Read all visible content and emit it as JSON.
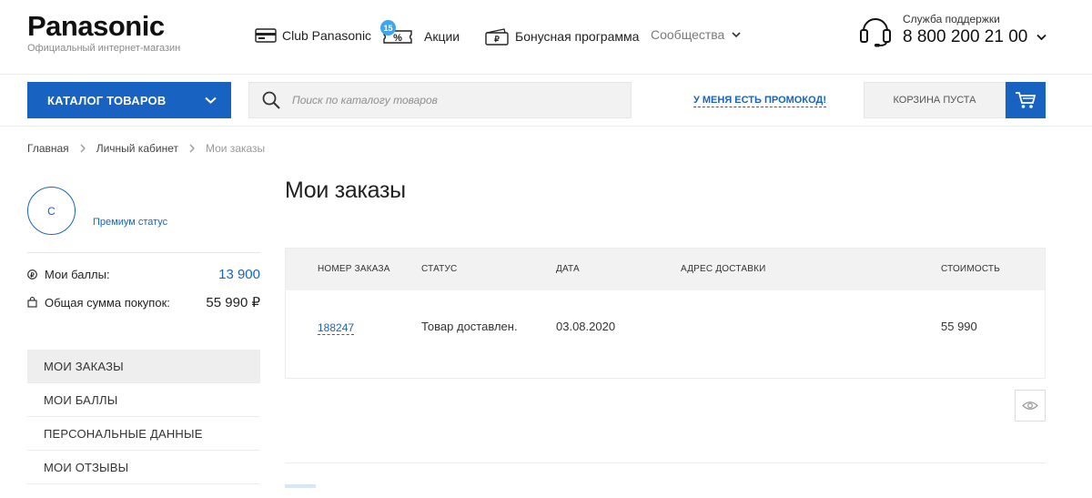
{
  "header": {
    "logo": "Panasonic",
    "logo_subtitle": "Официальный интернет-магазин",
    "nav": {
      "club": "Club Panasonic",
      "promo": "Акции",
      "promo_badge": "15",
      "bonus": "Бонусная программа",
      "community": "Сообщества"
    },
    "support_label": "Служба поддержки",
    "support_phone": "8 800 200 21 00"
  },
  "search_row": {
    "catalog_label": "КАТАЛОГ ТОВАРОВ",
    "search_placeholder": "Поиск по каталогу товаров",
    "search_value": "",
    "promo_code_link": "У МЕНЯ ЕСТЬ ПРОМОКОД!",
    "cart_label": "КОРЗИНА ПУСТА"
  },
  "breadcrumb": [
    "Главная",
    "Личный кабинет",
    "Мои заказы"
  ],
  "sidebar": {
    "avatar_initial": "С",
    "status": "Премиум статус",
    "points_label": "Мои баллы:",
    "points_value": "13 900",
    "total_label": "Общая сумма покупок:",
    "total_value": "55 990 ₽",
    "menu": [
      {
        "label": "МОИ ЗАКАЗЫ",
        "active": true
      },
      {
        "label": "МОИ БАЛЛЫ",
        "active": false
      },
      {
        "label": "ПЕРСОНАЛЬНЫЕ ДАННЫЕ",
        "active": false
      },
      {
        "label": "МОИ ОТЗЫВЫ",
        "active": false
      }
    ]
  },
  "main": {
    "title": "Мои заказы",
    "table": {
      "columns": [
        "НОМЕР ЗАКАЗА",
        "СТАТУС",
        "ДАТА",
        "АДРЕС ДОСТАВКИ",
        "СТОИМОСТЬ"
      ],
      "rows": [
        {
          "number": "188247",
          "status": "Товар доставлен.",
          "date": "03.08.2020",
          "address": "",
          "price": "55 990"
        }
      ]
    }
  },
  "colors": {
    "brand_blue": "#1863c1",
    "badge_blue": "#3da5f4"
  },
  "icons": {
    "club": "card-icon",
    "promo": "percent-ticket-icon",
    "bonus": "ruble-wallet-icon",
    "support": "headset-icon",
    "search": "search-icon",
    "cart": "shopping-cart-icon",
    "points": "ruble-coin-icon",
    "total": "shopping-bag-icon",
    "view": "eye-icon"
  }
}
